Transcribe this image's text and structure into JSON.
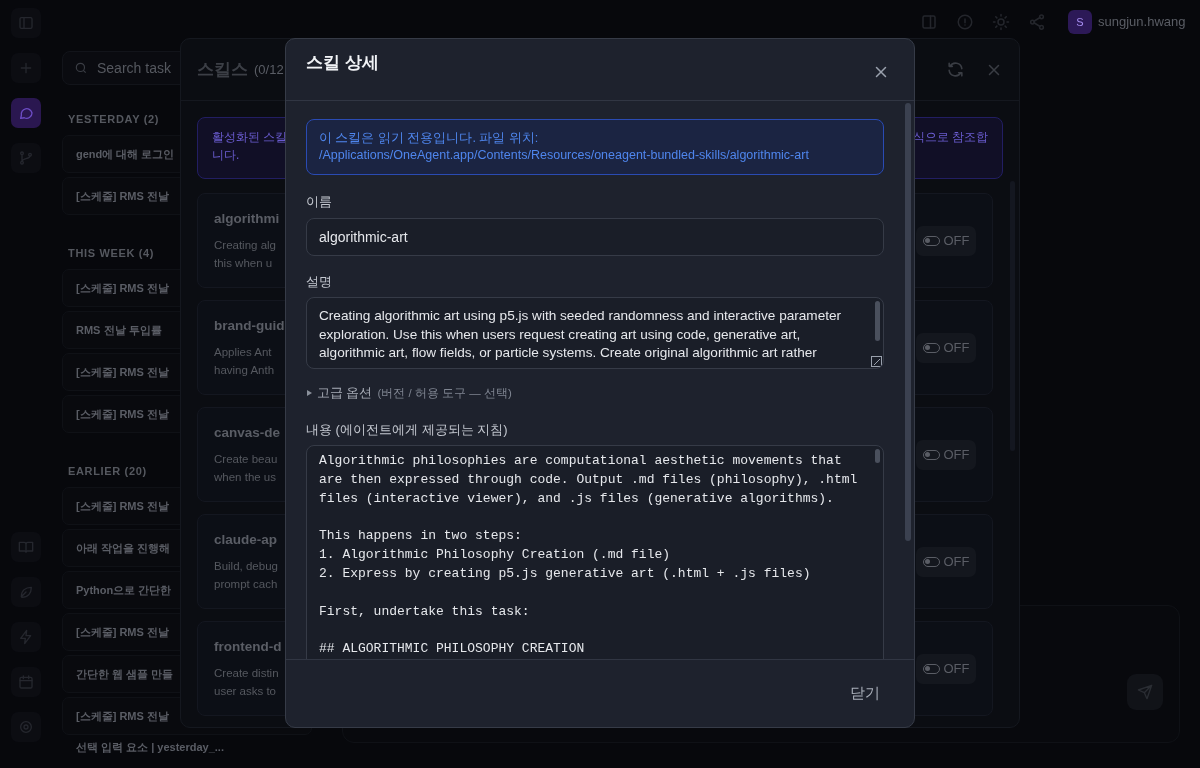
{
  "rail": {
    "top_items": [
      {
        "selected": false
      },
      {
        "selected": false
      },
      {
        "selected": true
      },
      {
        "selected": false
      }
    ]
  },
  "sidebar": {
    "search": {
      "placeholder": "Search task"
    },
    "groups": [
      {
        "title": "YESTERDAY (2)",
        "items": [
          "gend에 대해 로그인",
          "[스케줄] RMS 전날"
        ]
      },
      {
        "title": "THIS WEEK (4)",
        "items": [
          "[스케줄] RMS 전날",
          "RMS 전날 투입률",
          "[스케줄] RMS 전날",
          "[스케줄] RMS 전날"
        ]
      },
      {
        "title": "EARLIER (20)",
        "items": [
          "[스케줄] RMS 전날",
          "아래 작업을 진행해",
          "Python으로 간단한",
          "[스케줄] RMS 전날",
          "간단한 웹 샘플 만들",
          "[스케줄] RMS 전날"
        ]
      }
    ],
    "bottom_item": "선택 입력 요소 | yesterday_..."
  },
  "topbar": {
    "avatar": "S",
    "user": "sungjun.hwang"
  },
  "skills_panel": {
    "title": "스킬스",
    "count": "(0/12",
    "notice_left": "활성화된 스킬",
    "notice_right": "식으로 참조합",
    "notice_line2": "니다.",
    "skills": [
      {
        "name": "algorithmi",
        "description": [
          "Creating alg",
          "this when u"
        ],
        "on": false,
        "toggle": "OFF"
      },
      {
        "name": "brand-guid",
        "description": [
          "Applies Ant",
          "having Anth"
        ],
        "on": false,
        "toggle": "OFF"
      },
      {
        "name": "canvas-de",
        "description": [
          "Create beau",
          "when the us"
        ],
        "on": false,
        "toggle": "OFF"
      },
      {
        "name": "claude-ap",
        "description": [
          "Build, debug",
          "prompt cach"
        ],
        "on": false,
        "toggle": "OFF"
      },
      {
        "name": "frontend-d",
        "description": [
          "Create distin",
          "user asks to"
        ],
        "on": false,
        "toggle": "OFF"
      }
    ]
  },
  "dialog": {
    "title": "스킬 상세",
    "notice": "이 스킬은 읽기 전용입니다. 파일 위치: /Applications/OneAgent.app/Contents/Resources/oneagent-bundled-skills/algorithmic-art",
    "name_label": "이름",
    "name_value": "algorithmic-art",
    "description_label": "설명",
    "description": "Creating algorithmic art using p5.js with seeded randomness and interactive parameter exploration. Use this when users request creating art using code, generative art, algorithmic art, flow fields, or particle systems. Create original algorithmic art rather",
    "advanced": {
      "label": "고급 옵션",
      "hint": "(버전 / 허용 도구 — 선택)",
      "expanded": false
    },
    "content_label": "내용 (에이전트에게 제공되는 지침)",
    "content": "Algorithmic philosophies are computational aesthetic movements that are then expressed through code. Output .md files (philosophy), .html files (interactive viewer), and .js files (generative algorithms).\n\nThis happens in two steps:\n1. Algorithmic Philosophy Creation (.md file)\n2. Express by creating p5.js generative art (.html + .js files)\n\nFirst, undertake this task:\n\n## ALGORITHMIC PHILOSOPHY CREATION",
    "close_button": "닫기"
  }
}
